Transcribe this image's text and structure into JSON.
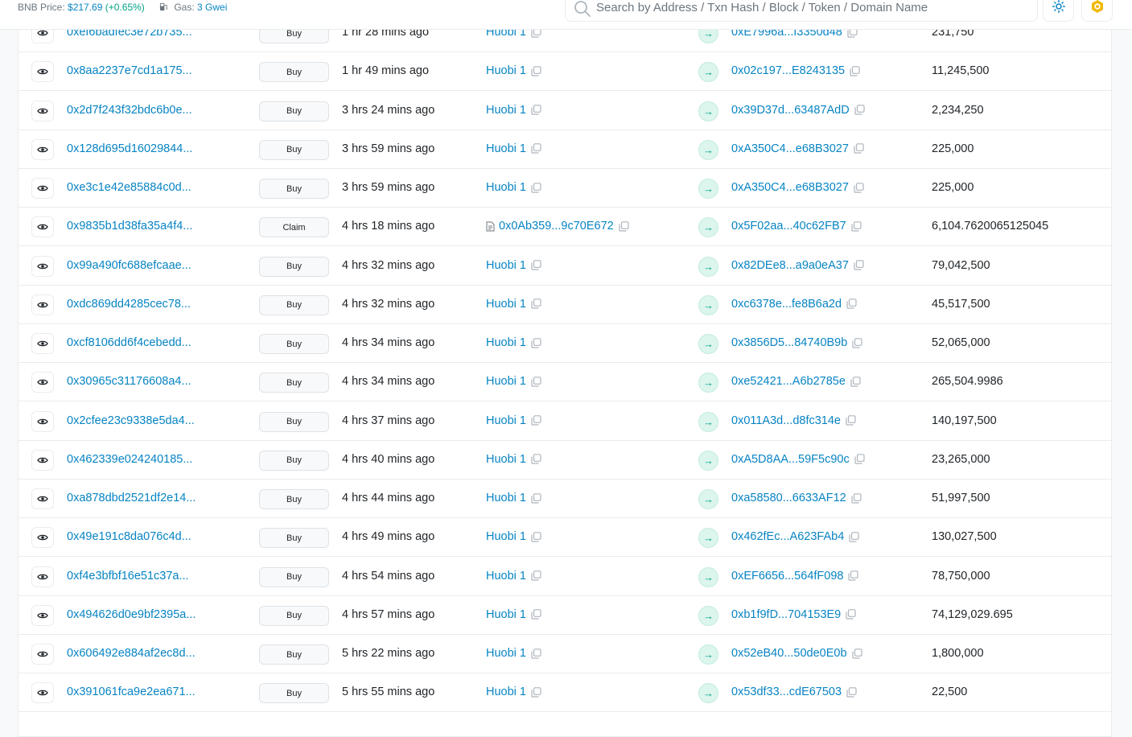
{
  "header": {
    "price_label": "BNB Price:",
    "price_value": "$217.69",
    "price_change": "(+0.65%)",
    "gas_label": "Gas:",
    "gas_value": "3 Gwei",
    "search_placeholder": "Search by Address / Txn Hash / Block / Token / Domain Name",
    "icons": [
      "gas-pump-icon",
      "search-icon",
      "sun-icon",
      "bnb-logo-icon"
    ]
  },
  "colors": {
    "link": "#0784c3",
    "success": "#00a186",
    "border": "#e9ecef"
  },
  "rows": [
    {
      "hash": "0xef6badfec3e72b735...",
      "method": "Buy",
      "age": "1 hr 28 mins ago",
      "from": "Huobi 1",
      "from_is_contract": false,
      "to": "0xE7996a...f3350d48",
      "quantity": "231,750"
    },
    {
      "hash": "0x8aa2237e7cd1a175...",
      "method": "Buy",
      "age": "1 hr 49 mins ago",
      "from": "Huobi 1",
      "from_is_contract": false,
      "to": "0x02c197...E8243135",
      "quantity": "11,245,500"
    },
    {
      "hash": "0x2d7f243f32bdc6b0e...",
      "method": "Buy",
      "age": "3 hrs 24 mins ago",
      "from": "Huobi 1",
      "from_is_contract": false,
      "to": "0x39D37d...63487AdD",
      "quantity": "2,234,250"
    },
    {
      "hash": "0x128d695d16029844...",
      "method": "Buy",
      "age": "3 hrs 59 mins ago",
      "from": "Huobi 1",
      "from_is_contract": false,
      "to": "0xA350C4...e68B3027",
      "quantity": "225,000"
    },
    {
      "hash": "0xe3c1e42e85884c0d...",
      "method": "Buy",
      "age": "3 hrs 59 mins ago",
      "from": "Huobi 1",
      "from_is_contract": false,
      "to": "0xA350C4...e68B3027",
      "quantity": "225,000"
    },
    {
      "hash": "0x9835b1d38fa35a4f4...",
      "method": "Claim",
      "age": "4 hrs 18 mins ago",
      "from": "0x0Ab359...9c70E672",
      "from_is_contract": true,
      "to": "0x5F02aa...40c62FB7",
      "quantity": "6,104.7620065125045"
    },
    {
      "hash": "0x99a490fc688efcaae...",
      "method": "Buy",
      "age": "4 hrs 32 mins ago",
      "from": "Huobi 1",
      "from_is_contract": false,
      "to": "0x82DEe8...a9a0eA37",
      "quantity": "79,042,500"
    },
    {
      "hash": "0xdc869dd4285cec78...",
      "method": "Buy",
      "age": "4 hrs 32 mins ago",
      "from": "Huobi 1",
      "from_is_contract": false,
      "to": "0xc6378e...fe8B6a2d",
      "quantity": "45,517,500"
    },
    {
      "hash": "0xcf8106dd6f4cebedd...",
      "method": "Buy",
      "age": "4 hrs 34 mins ago",
      "from": "Huobi 1",
      "from_is_contract": false,
      "to": "0x3856D5...84740B9b",
      "quantity": "52,065,000"
    },
    {
      "hash": "0x30965c31176608a4...",
      "method": "Buy",
      "age": "4 hrs 34 mins ago",
      "from": "Huobi 1",
      "from_is_contract": false,
      "to": "0xe52421...A6b2785e",
      "quantity": "265,504.9986"
    },
    {
      "hash": "0x2cfee23c9338e5da4...",
      "method": "Buy",
      "age": "4 hrs 37 mins ago",
      "from": "Huobi 1",
      "from_is_contract": false,
      "to": "0x011A3d...d8fc314e",
      "quantity": "140,197,500"
    },
    {
      "hash": "0x462339e024240185...",
      "method": "Buy",
      "age": "4 hrs 40 mins ago",
      "from": "Huobi 1",
      "from_is_contract": false,
      "to": "0xA5D8AA...59F5c90c",
      "quantity": "23,265,000"
    },
    {
      "hash": "0xa878dbd2521df2e14...",
      "method": "Buy",
      "age": "4 hrs 44 mins ago",
      "from": "Huobi 1",
      "from_is_contract": false,
      "to": "0xa58580...6633AF12",
      "quantity": "51,997,500"
    },
    {
      "hash": "0x49e191c8da076c4d...",
      "method": "Buy",
      "age": "4 hrs 49 mins ago",
      "from": "Huobi 1",
      "from_is_contract": false,
      "to": "0x462fEc...A623FAb4",
      "quantity": "130,027,500"
    },
    {
      "hash": "0xf4e3bfbf16e51c37a...",
      "method": "Buy",
      "age": "4 hrs 54 mins ago",
      "from": "Huobi 1",
      "from_is_contract": false,
      "to": "0xEF6656...564fF098",
      "quantity": "78,750,000"
    },
    {
      "hash": "0x494626d0e9bf2395a...",
      "method": "Buy",
      "age": "4 hrs 57 mins ago",
      "from": "Huobi 1",
      "from_is_contract": false,
      "to": "0xb1f9fD...704153E9",
      "quantity": "74,129,029.695"
    },
    {
      "hash": "0x606492e884af2ec8d...",
      "method": "Buy",
      "age": "5 hrs 22 mins ago",
      "from": "Huobi 1",
      "from_is_contract": false,
      "to": "0x52eB40...50de0E0b",
      "quantity": "1,800,000"
    },
    {
      "hash": "0x391061fca9e2ea671...",
      "method": "Buy",
      "age": "5 hrs 55 mins ago",
      "from": "Huobi 1",
      "from_is_contract": false,
      "to": "0x53df33...cdE67503",
      "quantity": "22,500"
    }
  ]
}
